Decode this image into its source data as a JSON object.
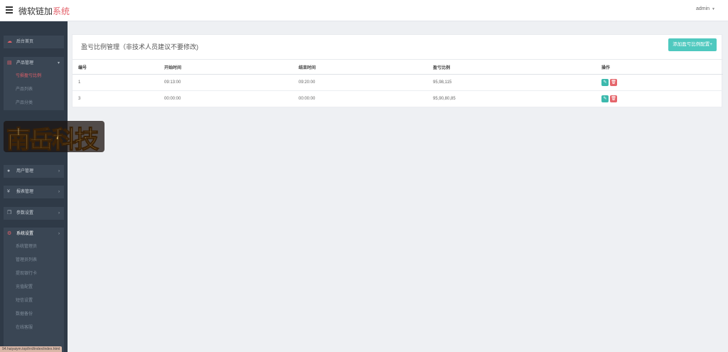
{
  "header": {
    "brand_main": "微软链加",
    "brand_accent": "系统",
    "user": "admin"
  },
  "sidebar": {
    "home": "后台首页",
    "product": "产品管理",
    "product_subs": [
      "亏损盈亏比例",
      "产品列表",
      "产品分类"
    ],
    "user": "用户管理",
    "report": "报表管理",
    "params": "参数设置",
    "system": "系统设置",
    "system_subs": [
      "系统管理员",
      "管理员列表",
      "提现银行卡",
      "充值配置",
      "短信设置",
      "数据备份",
      "在线客服"
    ]
  },
  "logo_overlay": {
    "text": "南岳科技",
    "icon": "brand-logo"
  },
  "panel": {
    "title": "盈亏比例管理（非技术人员建议不要修改)",
    "add_button": "添加盈亏比例配置+",
    "columns": [
      "编号",
      "开始时间",
      "结束时间",
      "盈亏比例",
      "操作"
    ],
    "rows": [
      {
        "id": "1",
        "start": "09:13:00",
        "end": "09:20:00",
        "ratio": "95,98,115"
      },
      {
        "id": "3",
        "start": "00:00:00",
        "end": "00:00:00",
        "ratio": "95,90,80,85"
      }
    ]
  },
  "status_bar": {
    "url": "94.haiyaiym.top/lrrd/index/index.html"
  },
  "colors": {
    "accent": "#e4616a",
    "teal": "#4fc9bf",
    "sidebar": "#2f3a47"
  }
}
